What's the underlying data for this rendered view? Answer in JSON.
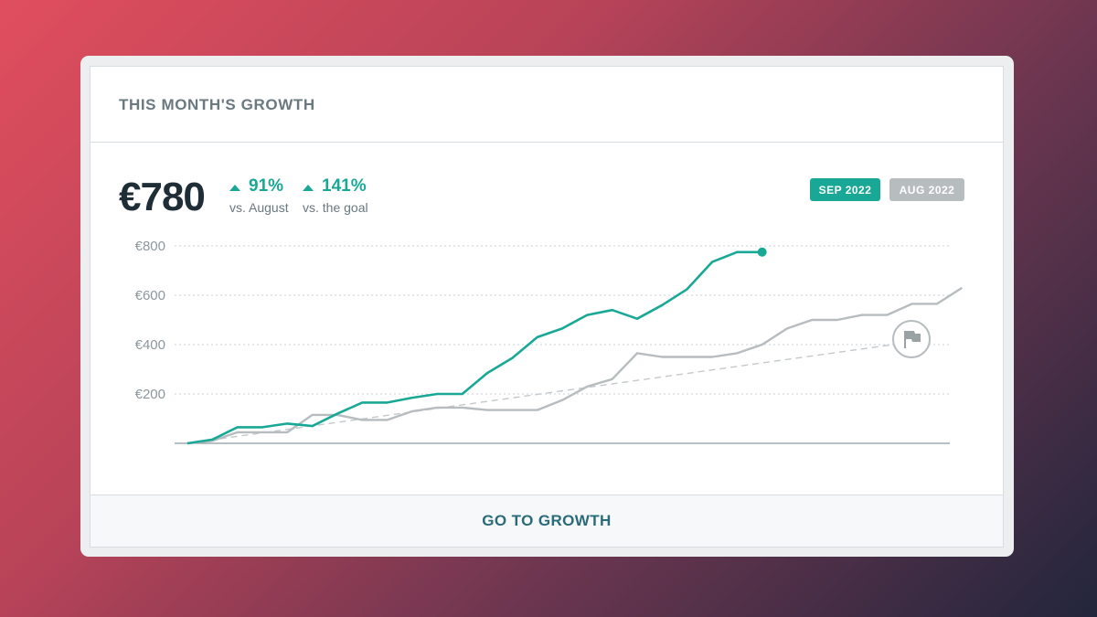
{
  "card": {
    "title": "THIS MONTH'S GROWTH",
    "amount": "€780",
    "stats": [
      {
        "value": "91%",
        "label": "vs. August"
      },
      {
        "value": "141%",
        "label": "vs. the goal"
      }
    ],
    "badges": {
      "current": "SEP 2022",
      "previous": "AUG 2022"
    },
    "footer_link": "GO TO GROWTH"
  },
  "colors": {
    "accent": "#1aa896",
    "previous": "#b7bcbf",
    "goal": "#c4c9cc",
    "link": "#2a6b7a"
  },
  "icons": {
    "goal_marker": "flag-icon"
  },
  "chart_data": {
    "type": "line",
    "ylim": [
      0,
      800
    ],
    "yticks": [
      200,
      400,
      600,
      800
    ],
    "ytick_labels": [
      "€200",
      "€400",
      "€600",
      "€800"
    ],
    "x_count": 31,
    "grid": true,
    "series": [
      {
        "values": [
          0,
          15,
          65,
          65,
          80,
          70,
          120,
          165,
          165,
          185,
          200,
          200,
          285,
          345,
          430,
          465,
          520,
          540,
          505,
          560,
          625,
          735,
          775,
          775
        ],
        "end_marker": true
      },
      {
        "values": [
          0,
          10,
          45,
          45,
          45,
          115,
          115,
          95,
          95,
          130,
          145,
          145,
          135,
          135,
          135,
          175,
          230,
          260,
          365,
          350,
          350,
          350,
          365,
          400,
          465,
          500,
          500,
          520,
          520,
          565,
          565,
          630
        ]
      }
    ],
    "goal": {
      "values": [
        0,
        400
      ]
    }
  }
}
